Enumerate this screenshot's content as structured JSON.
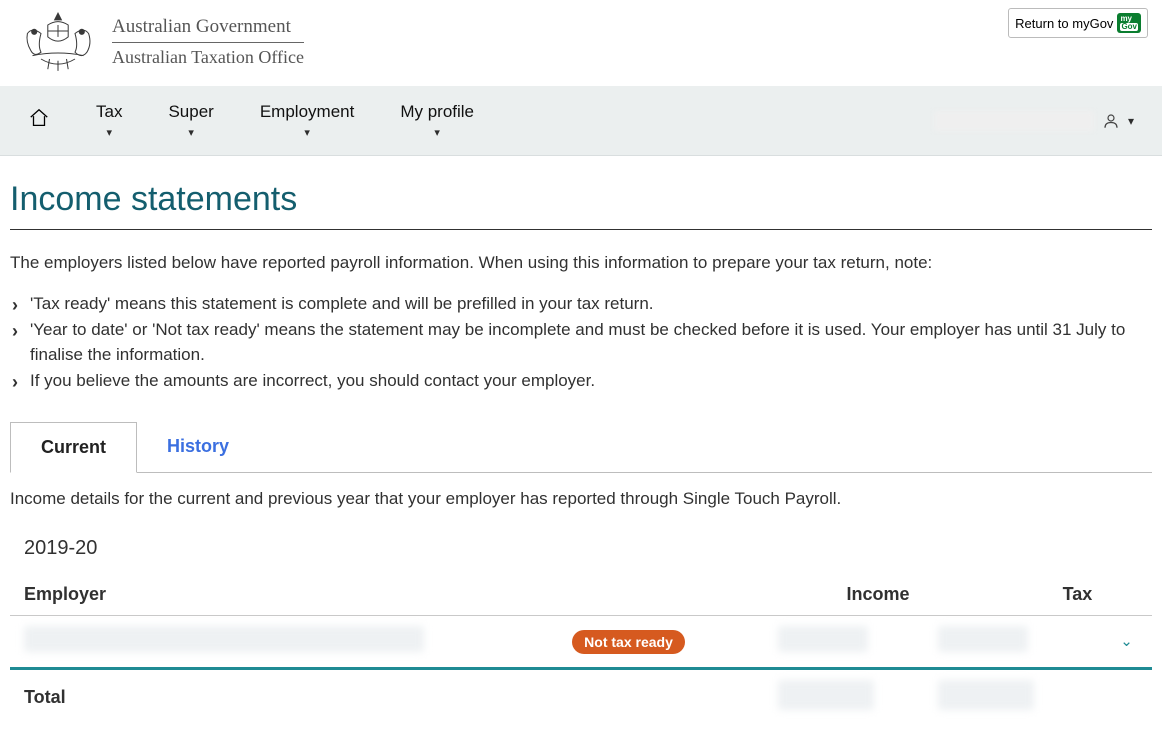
{
  "header": {
    "return_label": "Return to myGov",
    "logo_line1": "Australian Government",
    "logo_line2": "Australian Taxation Office",
    "mygov_badge_line1": "my",
    "mygov_badge_line2": "Gov"
  },
  "nav": {
    "items": [
      {
        "label": "Tax"
      },
      {
        "label": "Super"
      },
      {
        "label": "Employment"
      },
      {
        "label": "My profile"
      }
    ]
  },
  "page": {
    "title": "Income statements",
    "intro": "The employers listed below have reported payroll information. When using this information to prepare your tax return, note:",
    "notes": [
      "'Tax ready' means this statement is complete and will be prefilled in your tax return.",
      "'Year to date' or 'Not tax ready' means the statement may be incomplete and must be checked before it is used. Your employer has until 31 July to finalise the information.",
      "If you believe the amounts are incorrect, you should contact your employer."
    ]
  },
  "tabs": {
    "current": "Current",
    "history": "History"
  },
  "tab_subtext": "Income details for the current and previous year that your employer has reported through Single Touch Payroll.",
  "table": {
    "year": "2019-20",
    "columns": {
      "employer": "Employer",
      "income": "Income",
      "tax": "Tax"
    },
    "rows": [
      {
        "status_label": "Not tax ready"
      }
    ],
    "total_label": "Total"
  }
}
